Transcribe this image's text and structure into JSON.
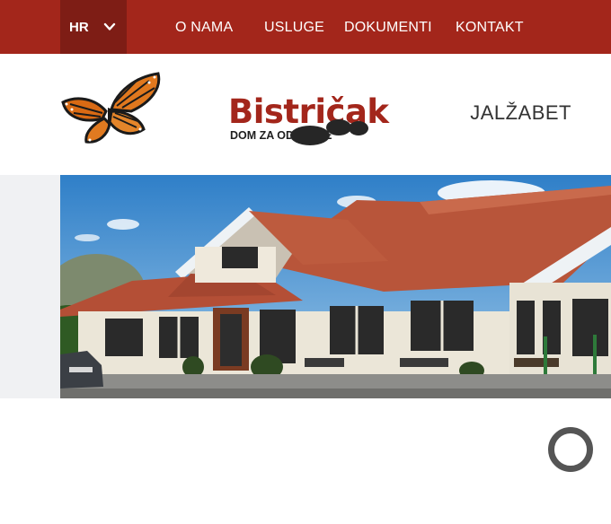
{
  "topbar": {
    "language": "HR",
    "nav": [
      "O NAMA",
      "USLUGE",
      "DOKUMENTI",
      "KONTAKT"
    ]
  },
  "header": {
    "brand_name": "Bistričak",
    "brand_sub": "DOM ZA ODRASLE",
    "location": "JALŽABET"
  },
  "colors": {
    "topbar": "#a3261b",
    "lang_bg": "#7e1d15",
    "brand": "#a3261b"
  },
  "icons": {
    "lang_toggle": "chevron-down-icon",
    "logo_art": "butterfly-icon",
    "loading": "spinner-icon"
  }
}
